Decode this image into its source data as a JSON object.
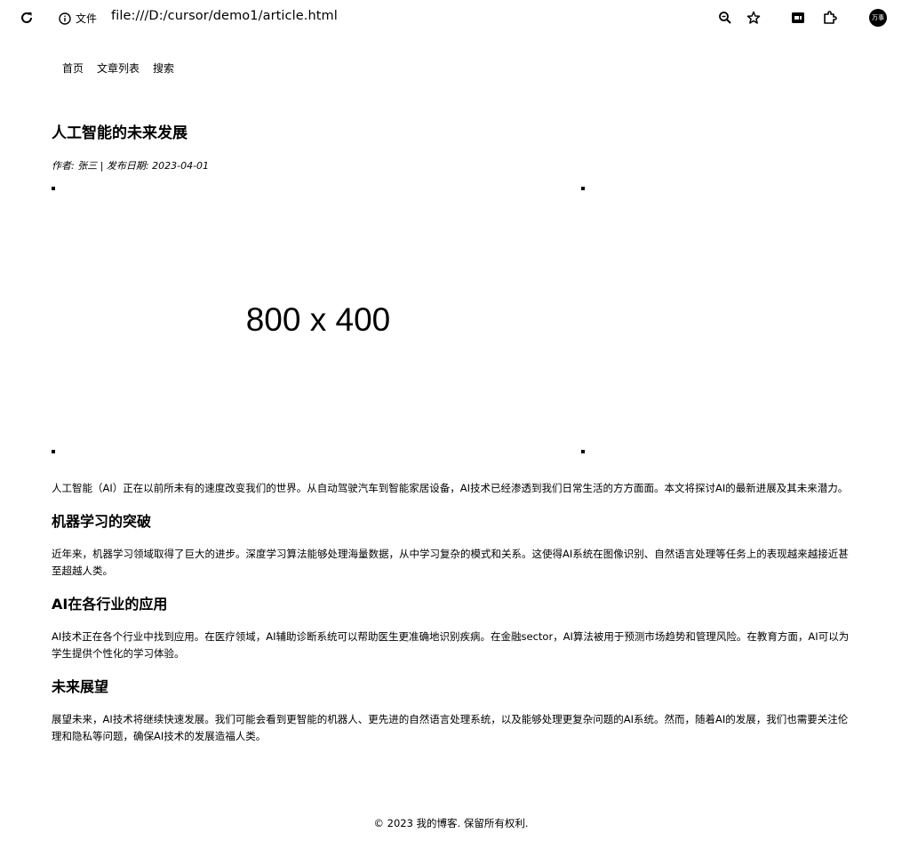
{
  "browser": {
    "site_label": "文件",
    "address": "file:///D:/cursor/demo1/article.html",
    "profile_label": "万事"
  },
  "icons": {
    "reload": "reload-icon",
    "info": "info-icon",
    "zoom": "zoom-icon",
    "bookmark": "star-icon",
    "extension_1": "extension-icon",
    "extension_2": "puzzle-icon",
    "profile": "avatar"
  },
  "nav": {
    "items": [
      "首页",
      "文章列表",
      "搜索"
    ]
  },
  "article": {
    "title": "人工智能的未来发展",
    "meta": "作者: 张三 | 发布日期: 2023-04-01",
    "image_text": "800 x 400",
    "intro": "人工智能（AI）正在以前所未有的速度改变我们的世界。从自动驾驶汽车到智能家居设备，AI技术已经渗透到我们日常生活的方方面面。本文将探讨AI的最新进展及其未来潜力。",
    "sections": [
      {
        "heading": "机器学习的突破",
        "text": "近年来，机器学习领域取得了巨大的进步。深度学习算法能够处理海量数据，从中学习复杂的模式和关系。这使得AI系统在图像识别、自然语言处理等任务上的表现越来越接近甚至超越人类。"
      },
      {
        "heading": "AI在各行业的应用",
        "text": "AI技术正在各个行业中找到应用。在医疗领域，AI辅助诊断系统可以帮助医生更准确地识别疾病。在金融sector，AI算法被用于预测市场趋势和管理风险。在教育方面，AI可以为学生提供个性化的学习体验。"
      },
      {
        "heading": "未来展望",
        "text": "展望未来，AI技术将继续快速发展。我们可能会看到更智能的机器人、更先进的自然语言处理系统，以及能够处理更复杂问题的AI系统。然而，随着AI的发展，我们也需要关注伦理和隐私等问题，确保AI技术的发展造福人类。"
      }
    ]
  },
  "footer": {
    "text": "© 2023 我的博客. 保留所有权利."
  }
}
